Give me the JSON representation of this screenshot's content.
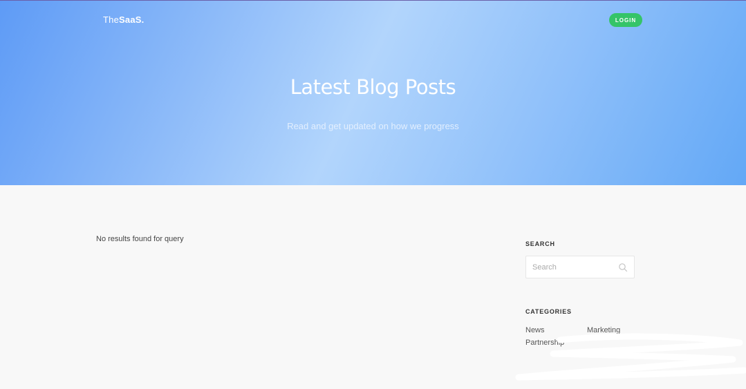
{
  "header": {
    "brand_prefix": "The",
    "brand_name": "SaaS.",
    "login_label": "LOGIN"
  },
  "hero": {
    "title": "Latest Blog Posts",
    "subtitle": "Read and get updated on how we progress"
  },
  "main": {
    "no_results_text": "No results found for query"
  },
  "sidebar": {
    "search": {
      "title": "SEARCH",
      "placeholder": "Search"
    },
    "categories": {
      "title": "CATEGORIES",
      "items": [
        "News",
        "Marketing",
        "Partnership"
      ]
    }
  },
  "colors": {
    "login_button": "#35c468",
    "hero_gradient_start": "#5e9bf6",
    "hero_gradient_mid": "#b2d5fc",
    "page_background": "#f8f8f8"
  }
}
